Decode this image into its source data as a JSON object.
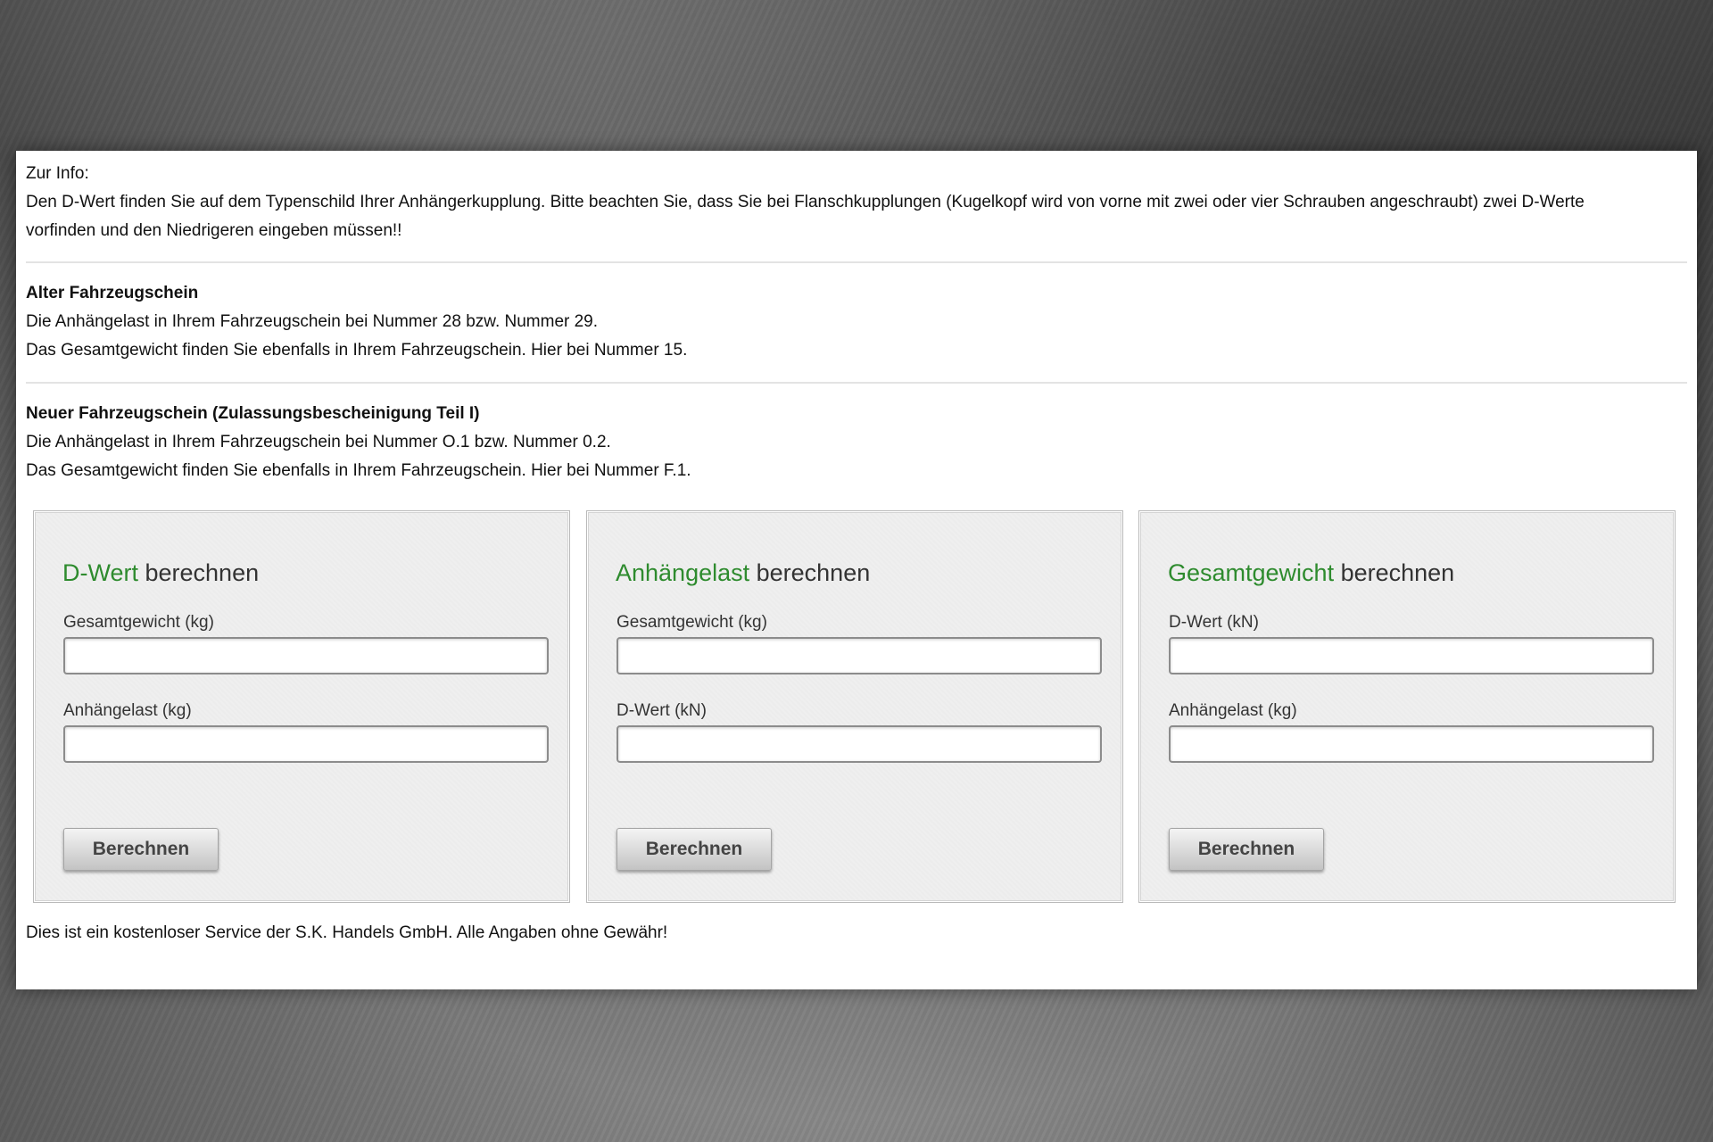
{
  "info": {
    "heading": "Zur Info:",
    "line1": "Den D-Wert finden Sie auf dem Typenschild Ihrer Anhängerkupplung. Bitte beachten Sie, dass Sie bei Flanschkupplungen (Kugelkopf wird von vorne mit zwei oder vier Schrauben angeschraubt) zwei D-Werte",
    "line2": "vorfinden und den Niedrigeren eingeben müssen!!"
  },
  "alter": {
    "heading": "Alter Fahrzeugschein",
    "line1": "Die Anhängelast in Ihrem Fahrzeugschein bei Nummer 28 bzw. Nummer 29.",
    "line2": "Das Gesamtgewicht finden Sie ebenfalls in Ihrem Fahrzeugschein. Hier bei Nummer 15."
  },
  "neuer": {
    "heading": "Neuer Fahrzeugschein (Zulassungsbescheinigung Teil I)",
    "line1": "Die Anhängelast in Ihrem Fahrzeugschein bei Nummer O.1 bzw. Nummer 0.2.",
    "line2": "Das Gesamtgewicht finden Sie ebenfalls in Ihrem Fahrzeugschein. Hier bei Nummer F.1."
  },
  "panels": [
    {
      "title_highlight": "D-Wert",
      "title_rest": " berechnen",
      "field1_label": "Gesamtgewicht (kg)",
      "field1_value": "",
      "field2_label": "Anhängelast (kg)",
      "field2_value": "",
      "button_label": "Berechnen"
    },
    {
      "title_highlight": "Anhängelast",
      "title_rest": " berechnen",
      "field1_label": "Gesamtgewicht (kg)",
      "field1_value": "",
      "field2_label": "D-Wert (kN)",
      "field2_value": "",
      "button_label": "Berechnen"
    },
    {
      "title_highlight": "Gesamtgewicht",
      "title_rest": " berechnen",
      "field1_label": "D-Wert (kN)",
      "field1_value": "",
      "field2_label": "Anhängelast (kg)",
      "field2_value": "",
      "button_label": "Berechnen"
    }
  ],
  "footer": "Dies ist ein kostenloser Service der S.K. Handels GmbH. Alle Angaben ohne Gewähr!",
  "colors": {
    "highlight_green": "#2e8b2e",
    "panel_background": "#efefef"
  }
}
